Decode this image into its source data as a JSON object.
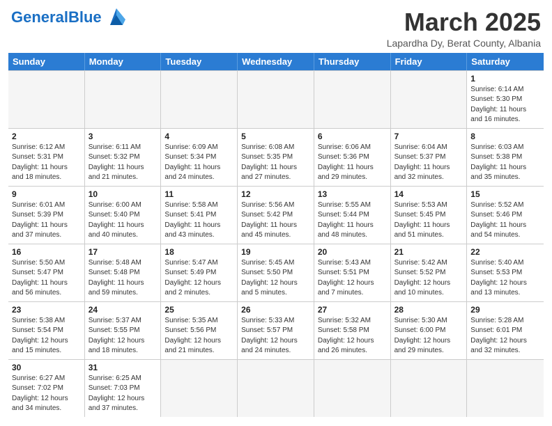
{
  "header": {
    "logo_general": "General",
    "logo_blue": "Blue",
    "month": "March 2025",
    "location": "Lapardha Dy, Berat County, Albania"
  },
  "weekdays": [
    "Sunday",
    "Monday",
    "Tuesday",
    "Wednesday",
    "Thursday",
    "Friday",
    "Saturday"
  ],
  "weeks": [
    [
      {
        "day": "",
        "info": ""
      },
      {
        "day": "",
        "info": ""
      },
      {
        "day": "",
        "info": ""
      },
      {
        "day": "",
        "info": ""
      },
      {
        "day": "",
        "info": ""
      },
      {
        "day": "",
        "info": ""
      },
      {
        "day": "1",
        "info": "Sunrise: 6:14 AM\nSunset: 5:30 PM\nDaylight: 11 hours\nand 16 minutes."
      }
    ],
    [
      {
        "day": "2",
        "info": "Sunrise: 6:12 AM\nSunset: 5:31 PM\nDaylight: 11 hours\nand 18 minutes."
      },
      {
        "day": "3",
        "info": "Sunrise: 6:11 AM\nSunset: 5:32 PM\nDaylight: 11 hours\nand 21 minutes."
      },
      {
        "day": "4",
        "info": "Sunrise: 6:09 AM\nSunset: 5:34 PM\nDaylight: 11 hours\nand 24 minutes."
      },
      {
        "day": "5",
        "info": "Sunrise: 6:08 AM\nSunset: 5:35 PM\nDaylight: 11 hours\nand 27 minutes."
      },
      {
        "day": "6",
        "info": "Sunrise: 6:06 AM\nSunset: 5:36 PM\nDaylight: 11 hours\nand 29 minutes."
      },
      {
        "day": "7",
        "info": "Sunrise: 6:04 AM\nSunset: 5:37 PM\nDaylight: 11 hours\nand 32 minutes."
      },
      {
        "day": "8",
        "info": "Sunrise: 6:03 AM\nSunset: 5:38 PM\nDaylight: 11 hours\nand 35 minutes."
      }
    ],
    [
      {
        "day": "9",
        "info": "Sunrise: 6:01 AM\nSunset: 5:39 PM\nDaylight: 11 hours\nand 37 minutes."
      },
      {
        "day": "10",
        "info": "Sunrise: 6:00 AM\nSunset: 5:40 PM\nDaylight: 11 hours\nand 40 minutes."
      },
      {
        "day": "11",
        "info": "Sunrise: 5:58 AM\nSunset: 5:41 PM\nDaylight: 11 hours\nand 43 minutes."
      },
      {
        "day": "12",
        "info": "Sunrise: 5:56 AM\nSunset: 5:42 PM\nDaylight: 11 hours\nand 45 minutes."
      },
      {
        "day": "13",
        "info": "Sunrise: 5:55 AM\nSunset: 5:44 PM\nDaylight: 11 hours\nand 48 minutes."
      },
      {
        "day": "14",
        "info": "Sunrise: 5:53 AM\nSunset: 5:45 PM\nDaylight: 11 hours\nand 51 minutes."
      },
      {
        "day": "15",
        "info": "Sunrise: 5:52 AM\nSunset: 5:46 PM\nDaylight: 11 hours\nand 54 minutes."
      }
    ],
    [
      {
        "day": "16",
        "info": "Sunrise: 5:50 AM\nSunset: 5:47 PM\nDaylight: 11 hours\nand 56 minutes."
      },
      {
        "day": "17",
        "info": "Sunrise: 5:48 AM\nSunset: 5:48 PM\nDaylight: 11 hours\nand 59 minutes."
      },
      {
        "day": "18",
        "info": "Sunrise: 5:47 AM\nSunset: 5:49 PM\nDaylight: 12 hours\nand 2 minutes."
      },
      {
        "day": "19",
        "info": "Sunrise: 5:45 AM\nSunset: 5:50 PM\nDaylight: 12 hours\nand 5 minutes."
      },
      {
        "day": "20",
        "info": "Sunrise: 5:43 AM\nSunset: 5:51 PM\nDaylight: 12 hours\nand 7 minutes."
      },
      {
        "day": "21",
        "info": "Sunrise: 5:42 AM\nSunset: 5:52 PM\nDaylight: 12 hours\nand 10 minutes."
      },
      {
        "day": "22",
        "info": "Sunrise: 5:40 AM\nSunset: 5:53 PM\nDaylight: 12 hours\nand 13 minutes."
      }
    ],
    [
      {
        "day": "23",
        "info": "Sunrise: 5:38 AM\nSunset: 5:54 PM\nDaylight: 12 hours\nand 15 minutes."
      },
      {
        "day": "24",
        "info": "Sunrise: 5:37 AM\nSunset: 5:55 PM\nDaylight: 12 hours\nand 18 minutes."
      },
      {
        "day": "25",
        "info": "Sunrise: 5:35 AM\nSunset: 5:56 PM\nDaylight: 12 hours\nand 21 minutes."
      },
      {
        "day": "26",
        "info": "Sunrise: 5:33 AM\nSunset: 5:57 PM\nDaylight: 12 hours\nand 24 minutes."
      },
      {
        "day": "27",
        "info": "Sunrise: 5:32 AM\nSunset: 5:58 PM\nDaylight: 12 hours\nand 26 minutes."
      },
      {
        "day": "28",
        "info": "Sunrise: 5:30 AM\nSunset: 6:00 PM\nDaylight: 12 hours\nand 29 minutes."
      },
      {
        "day": "29",
        "info": "Sunrise: 5:28 AM\nSunset: 6:01 PM\nDaylight: 12 hours\nand 32 minutes."
      }
    ],
    [
      {
        "day": "30",
        "info": "Sunrise: 6:27 AM\nSunset: 7:02 PM\nDaylight: 12 hours\nand 34 minutes."
      },
      {
        "day": "31",
        "info": "Sunrise: 6:25 AM\nSunset: 7:03 PM\nDaylight: 12 hours\nand 37 minutes."
      },
      {
        "day": "",
        "info": ""
      },
      {
        "day": "",
        "info": ""
      },
      {
        "day": "",
        "info": ""
      },
      {
        "day": "",
        "info": ""
      },
      {
        "day": "",
        "info": ""
      }
    ]
  ]
}
